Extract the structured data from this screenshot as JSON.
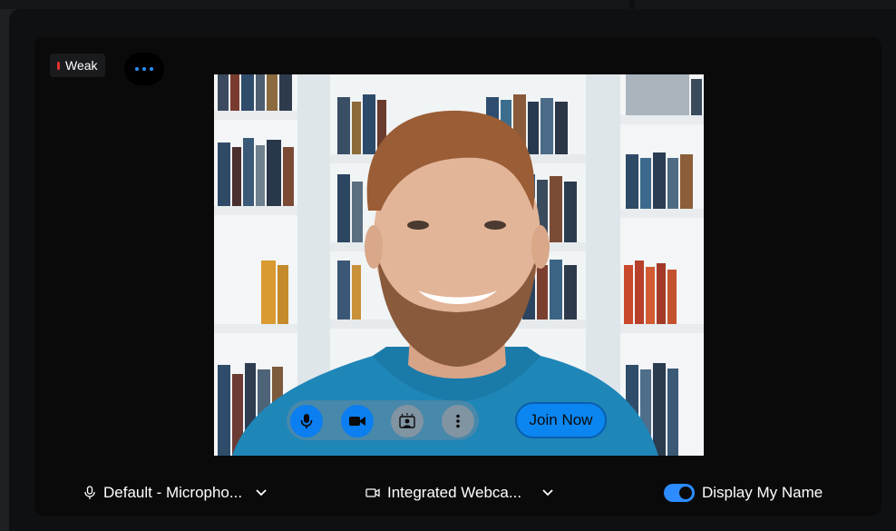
{
  "network": {
    "signal_label": "Weak",
    "signal_color": "#e5312f"
  },
  "preview_controls": {
    "mic_icon": "microphone-icon",
    "camera_icon": "video-camera-icon",
    "background_icon": "virtual-background-icon",
    "more_icon": "vertical-ellipsis-icon",
    "join_label": "Join Now"
  },
  "devices": {
    "microphone_label": "Default - Micropho...",
    "camera_label": "Integrated Webca...",
    "display_name_label": "Display My Name",
    "display_name_enabled": true
  },
  "colors": {
    "accent": "#2d8cff",
    "button_blue": "#0b7ef0"
  }
}
